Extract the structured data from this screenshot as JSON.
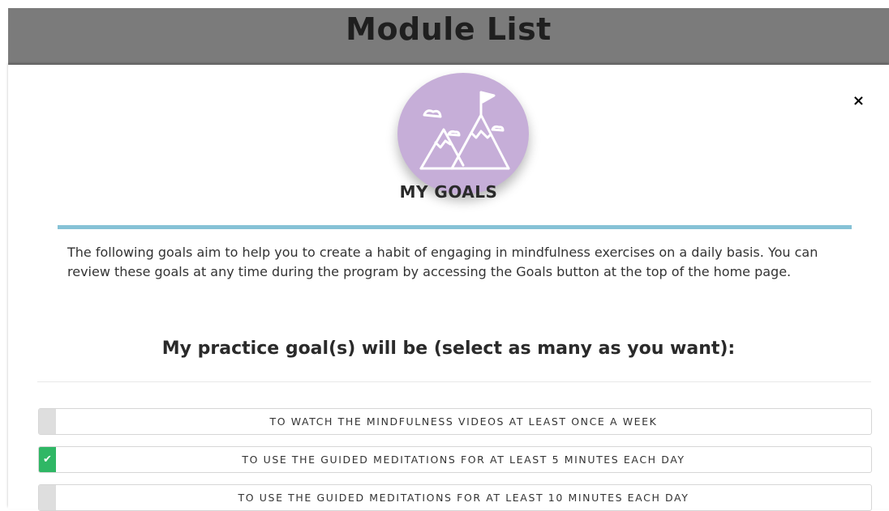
{
  "backdrop": {
    "title": "Module List"
  },
  "modal": {
    "badge_icon": "mountain-flag-icon",
    "close_glyph": "×",
    "heading": "MY GOALS",
    "intro": "The following goals aim to help you to create a habit of engaging in mindfulness exercises on a daily basis. You can review these goals at any time during the program by accessing the Goals button at the top of the home page.",
    "subheading": "My practice goal(s) will be (select as many as you want):",
    "options": [
      {
        "label": "TO WATCH THE MINDFULNESS VIDEOS AT LEAST ONCE A WEEK",
        "checked": false,
        "mark": ""
      },
      {
        "label": "TO USE THE GUIDED MEDITATIONS FOR AT LEAST 5 MINUTES EACH DAY",
        "checked": true,
        "mark": "✔"
      },
      {
        "label": "TO USE THE GUIDED MEDITATIONS FOR AT LEAST 10 MINUTES EACH DAY",
        "checked": false,
        "mark": ""
      }
    ]
  },
  "colors": {
    "badge": "#c6aed8",
    "accent_rule": "#86c2d6",
    "checked": "#2fb765",
    "unchecked": "#dedede",
    "backdrop": "#7b7b7b"
  }
}
